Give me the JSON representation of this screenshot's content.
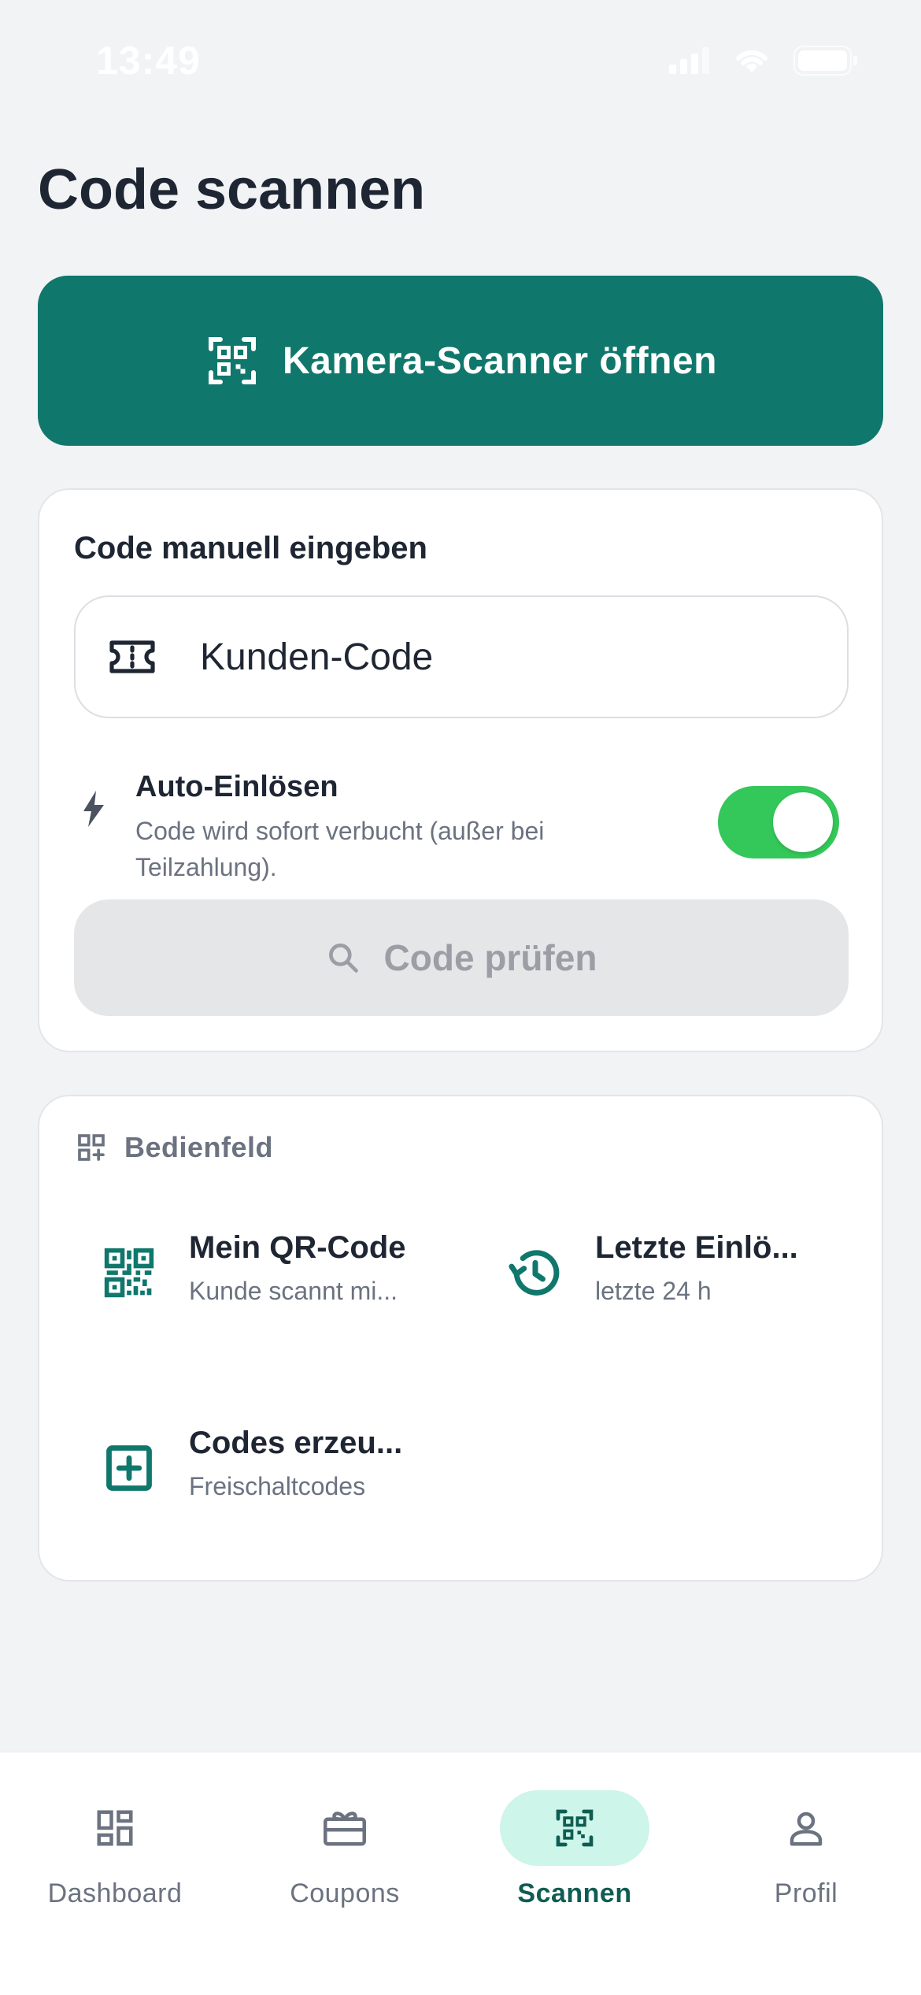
{
  "status_bar": {
    "time": "13:49"
  },
  "header": {
    "title": "Code scannen"
  },
  "camera_button": {
    "label": "Kamera-Scanner öffnen",
    "icon": "qr-scan-icon"
  },
  "manual_entry": {
    "title": "Code manuell eingeben",
    "input_placeholder": "Kunden-Code",
    "input_value": "",
    "auto_redeem": {
      "title": "Auto-Einlösen",
      "description": "Code wird sofort verbucht (außer bei Teilzahlung).",
      "enabled": true
    },
    "check_button_label": "Code prüfen"
  },
  "control_panel": {
    "title": "Bedienfeld",
    "tiles": [
      {
        "title": "Mein QR-Code",
        "subtitle": "Kunde scannt mi...",
        "icon": "qr-code-icon"
      },
      {
        "title": "Letzte Einlö...",
        "subtitle": "letzte 24 h",
        "icon": "history-icon"
      },
      {
        "title": "Codes erzeu...",
        "subtitle": "Freischaltcodes",
        "icon": "add-box-icon"
      }
    ]
  },
  "bottom_nav": {
    "items": [
      {
        "label": "Dashboard",
        "icon": "dashboard-icon",
        "active": false
      },
      {
        "label": "Coupons",
        "icon": "gift-card-icon",
        "active": false
      },
      {
        "label": "Scannen",
        "icon": "qr-scan-icon",
        "active": true
      },
      {
        "label": "Profil",
        "icon": "person-icon",
        "active": false
      }
    ]
  },
  "colors": {
    "primary": "#10776c",
    "toggle_on": "#34c759",
    "active_nav_bg": "#cdf5ea",
    "background": "#f2f3f5"
  }
}
